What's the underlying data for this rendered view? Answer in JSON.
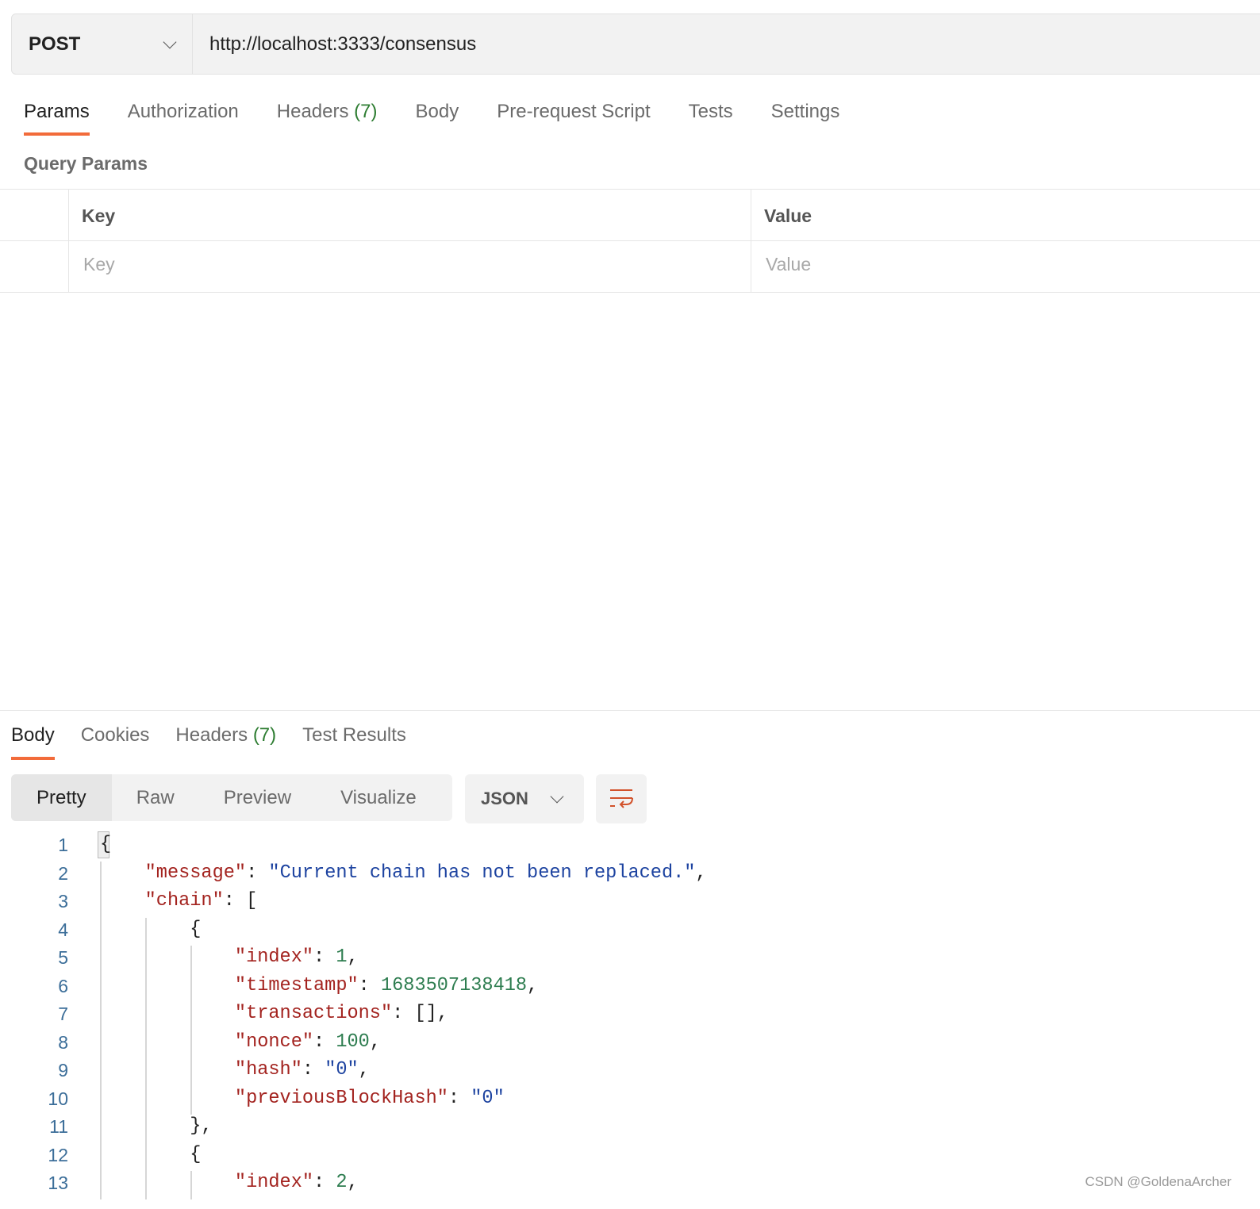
{
  "request": {
    "method": "POST",
    "url": "http://localhost:3333/consensus",
    "tabs": [
      {
        "label": "Params",
        "active": true
      },
      {
        "label": "Authorization"
      },
      {
        "label": "Headers",
        "count": "(7)"
      },
      {
        "label": "Body"
      },
      {
        "label": "Pre-request Script"
      },
      {
        "label": "Tests"
      },
      {
        "label": "Settings"
      }
    ],
    "query_params_title": "Query Params",
    "table": {
      "headers": [
        "Key",
        "Value"
      ],
      "placeholders": [
        "Key",
        "Value"
      ]
    }
  },
  "response": {
    "tabs": [
      {
        "label": "Body",
        "active": true
      },
      {
        "label": "Cookies"
      },
      {
        "label": "Headers",
        "count": "(7)"
      },
      {
        "label": "Test Results"
      }
    ],
    "views": [
      "Pretty",
      "Raw",
      "Preview",
      "Visualize"
    ],
    "selected_view": "Pretty",
    "format": "JSON",
    "code_lines": [
      [
        [
          "p",
          "{"
        ]
      ],
      [
        [
          "p",
          "    "
        ],
        [
          "k",
          "\"message\""
        ],
        [
          "p",
          ": "
        ],
        [
          "s",
          "\"Current chain has not been replaced.\""
        ],
        [
          "p",
          ","
        ]
      ],
      [
        [
          "p",
          "    "
        ],
        [
          "k",
          "\"chain\""
        ],
        [
          "p",
          ": ["
        ]
      ],
      [
        [
          "p",
          "        {"
        ]
      ],
      [
        [
          "p",
          "            "
        ],
        [
          "k",
          "\"index\""
        ],
        [
          "p",
          ": "
        ],
        [
          "n",
          "1"
        ],
        [
          "p",
          ","
        ]
      ],
      [
        [
          "p",
          "            "
        ],
        [
          "k",
          "\"timestamp\""
        ],
        [
          "p",
          ": "
        ],
        [
          "n",
          "1683507138418"
        ],
        [
          "p",
          ","
        ]
      ],
      [
        [
          "p",
          "            "
        ],
        [
          "k",
          "\"transactions\""
        ],
        [
          "p",
          ": [],"
        ]
      ],
      [
        [
          "p",
          "            "
        ],
        [
          "k",
          "\"nonce\""
        ],
        [
          "p",
          ": "
        ],
        [
          "n",
          "100"
        ],
        [
          "p",
          ","
        ]
      ],
      [
        [
          "p",
          "            "
        ],
        [
          "k",
          "\"hash\""
        ],
        [
          "p",
          ": "
        ],
        [
          "s",
          "\"0\""
        ],
        [
          "p",
          ","
        ]
      ],
      [
        [
          "p",
          "            "
        ],
        [
          "k",
          "\"previousBlockHash\""
        ],
        [
          "p",
          ": "
        ],
        [
          "s",
          "\"0\""
        ]
      ],
      [
        [
          "p",
          "        },"
        ]
      ],
      [
        [
          "p",
          "        {"
        ]
      ],
      [
        [
          "p",
          "            "
        ],
        [
          "k",
          "\"index\""
        ],
        [
          "p",
          ": "
        ],
        [
          "n",
          "2"
        ],
        [
          "p",
          ","
        ]
      ]
    ]
  },
  "icons": {
    "method_dropdown": "chevron-down-icon",
    "format_dropdown": "chevron-down-icon",
    "wrap": "wrap-lines-icon"
  },
  "colors": {
    "accent": "#f26b3a",
    "count": "#2e7d32",
    "json_key": "#a3231f",
    "json_string": "#1d43a0",
    "json_number": "#2e7d50"
  },
  "watermark": "CSDN @GoldenaArcher"
}
